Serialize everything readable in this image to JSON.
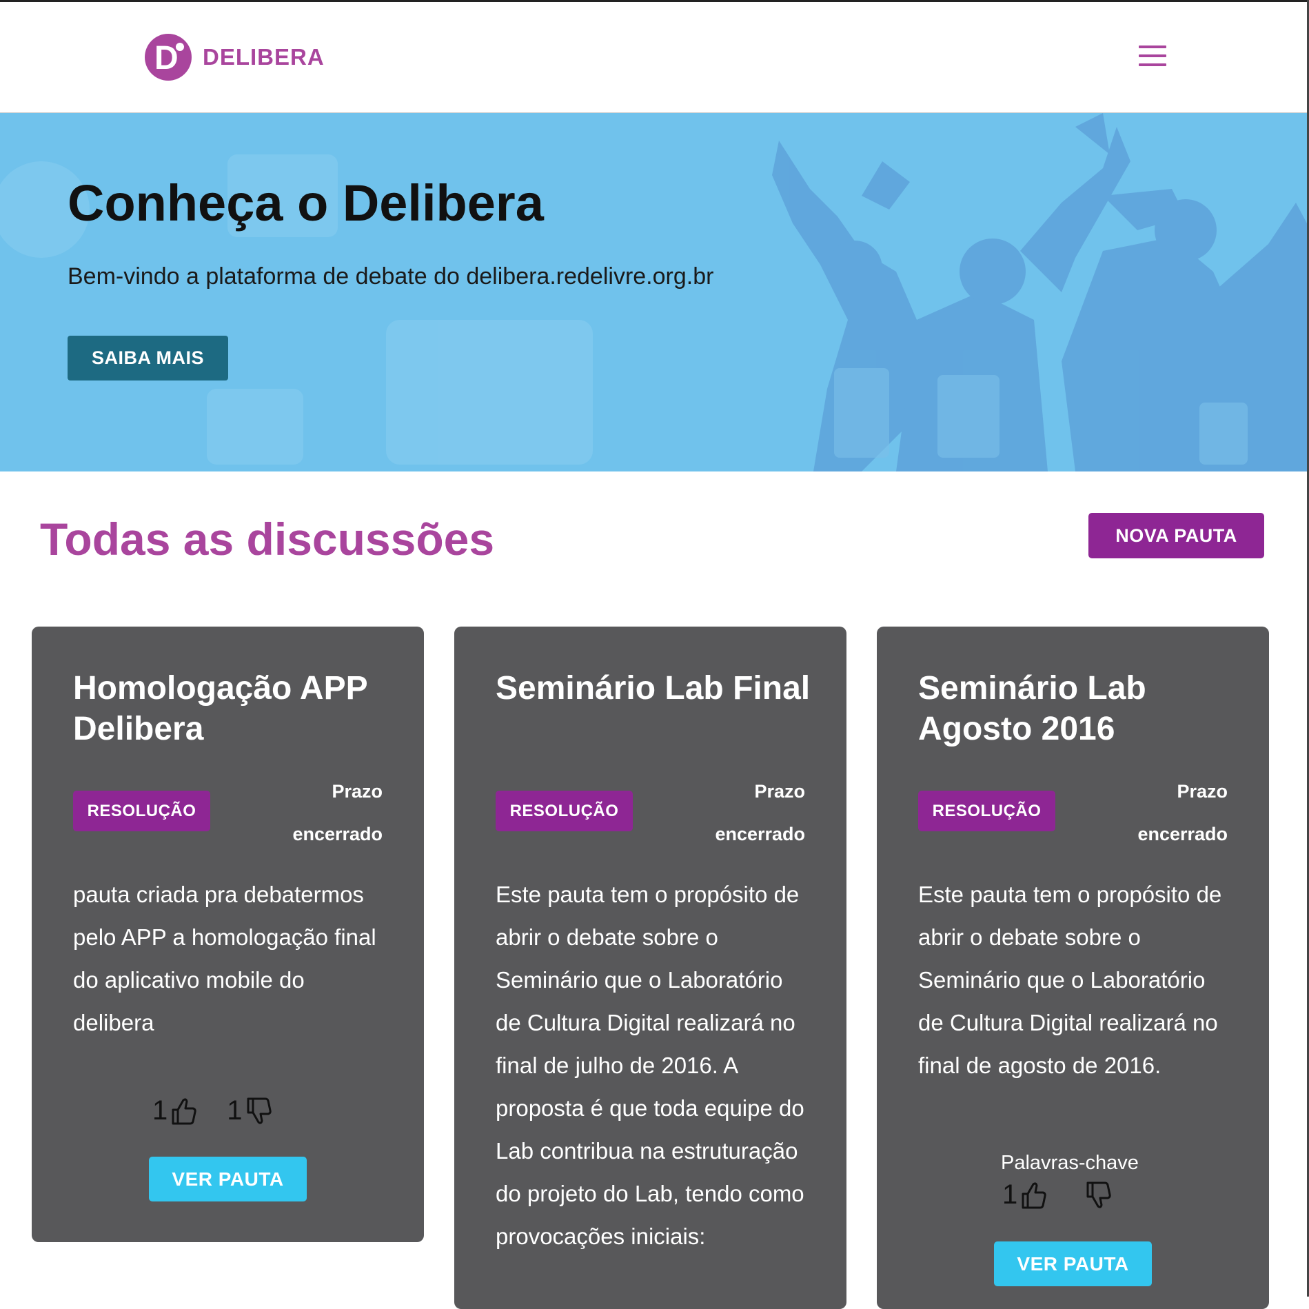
{
  "header": {
    "logo_text": "DELIBERA",
    "logo_letter": "D",
    "brand_color": "#a9459d"
  },
  "hero": {
    "title": "Conheça o Delibera",
    "subtitle": "Bem-vindo a plataforma de debate do delibera.redelivre.org.br",
    "button_label": "SAIBA MAIS"
  },
  "section": {
    "title": "Todas as discussões",
    "new_button_label": "NOVA PAUTA"
  },
  "cards": [
    {
      "title": "Homologação APP Delibera",
      "badge": "RESOLUÇÃO",
      "prazo_line1": "Prazo",
      "prazo_line2": "encerrado",
      "description": "pauta criada pra debatermos pelo APP a homologação final do aplicativo mobile do delibera",
      "likes": "1",
      "dislikes": "1",
      "button_label": "VER PAUTA"
    },
    {
      "title": "Seminário Lab Final",
      "badge": "RESOLUÇÃO",
      "prazo_line1": "Prazo",
      "prazo_line2": "encerrado",
      "description": "Este pauta tem o propósito de abrir o debate sobre o Seminário que o Laboratório de Cultura Digital realizará no final de julho de 2016. A proposta é que toda equipe do Lab contribua na estruturação do projeto do Lab, tendo como provocações iniciais:"
    },
    {
      "title": "Seminário Lab Agosto 2016",
      "badge": "RESOLUÇÃO",
      "prazo_line1": "Prazo",
      "prazo_line2": "encerrado",
      "description": "Este pauta tem o propósito de abrir o debate sobre o Seminário que o Laboratório de Cultura Digital realizará no final de agosto de 2016.",
      "keywords_label": "Palavras-chave",
      "likes": "1",
      "dislikes": "",
      "button_label": "VER PAUTA"
    }
  ],
  "colors": {
    "hero_bg": "#70c2ec",
    "saiba_button": "#1d6a82",
    "purple_button": "#8e2694",
    "card_bg": "#58585a",
    "ver_button": "#33c6ef"
  }
}
